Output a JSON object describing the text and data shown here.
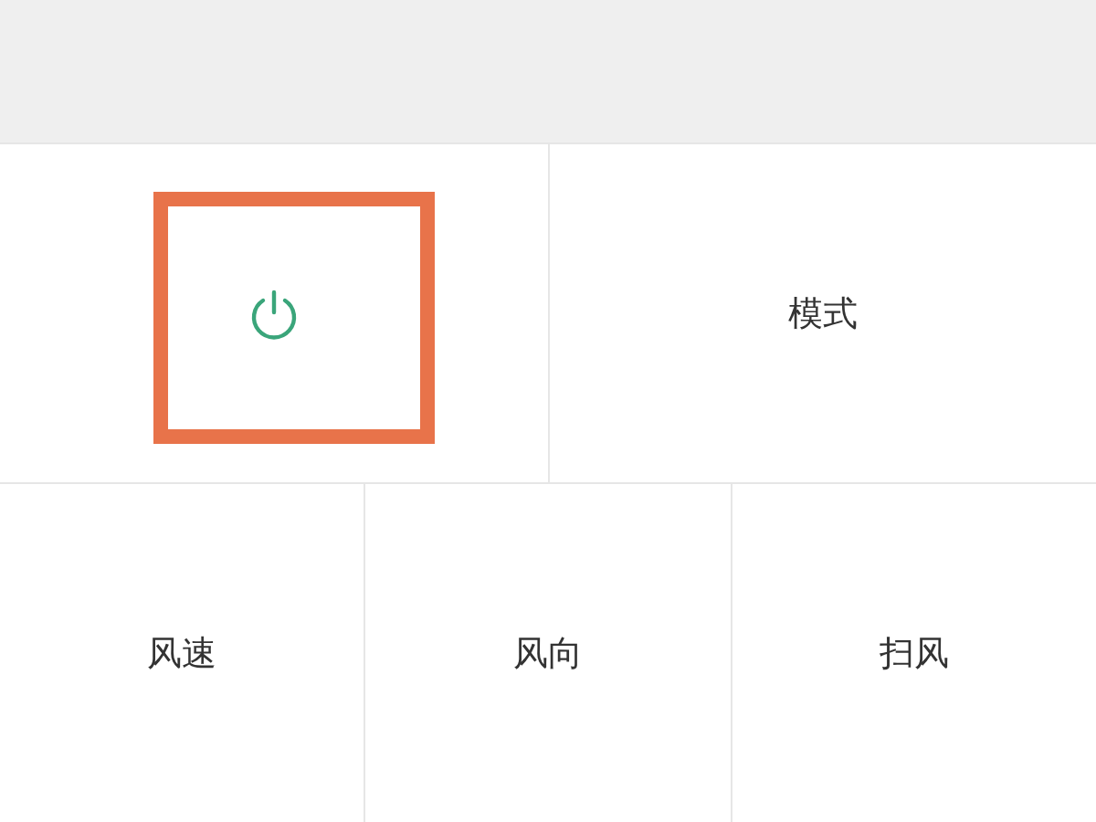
{
  "top_row": [
    {
      "kind": "power",
      "highlighted": true
    },
    {
      "kind": "label",
      "label": "模式"
    }
  ],
  "bottom_row": [
    {
      "label": "风速"
    },
    {
      "label": "风向"
    },
    {
      "label": "扫风"
    }
  ]
}
